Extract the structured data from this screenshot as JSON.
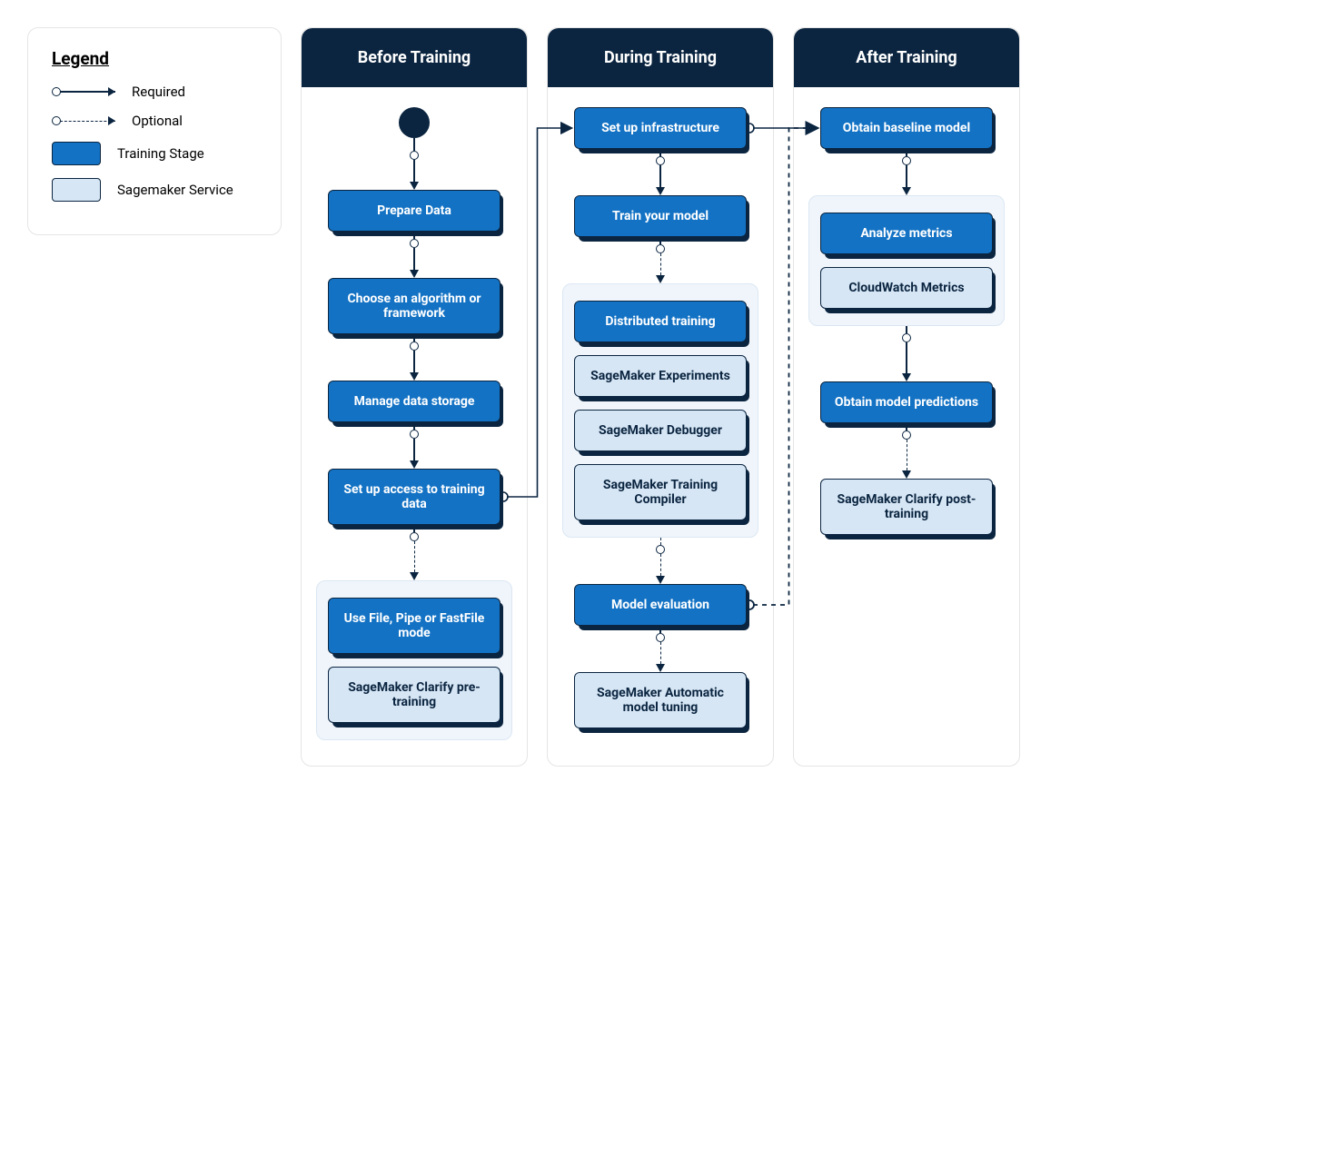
{
  "legend": {
    "title": "Legend",
    "required": "Required",
    "optional": "Optional",
    "training_stage": "Training Stage",
    "sagemaker_service": "Sagemaker Service"
  },
  "columns": {
    "before": {
      "header": "Before Training",
      "prepare_data": "Prepare Data",
      "choose_algo": "Choose an algorithm or framework",
      "manage_storage": "Manage data storage",
      "setup_access": "Set up access to training data",
      "file_mode": "Use File, Pipe or FastFile mode",
      "clarify_pre": "SageMaker Clarify pre-training"
    },
    "during": {
      "header": "During Training",
      "setup_infra": "Set up infrastructure",
      "train_model": "Train your model",
      "distributed": "Distributed training",
      "experiments": "SageMaker Experiments",
      "debugger": "SageMaker Debugger",
      "compiler": "SageMaker Training Compiler",
      "model_eval": "Model evaluation",
      "auto_tuning": "SageMaker Automatic model tuning"
    },
    "after": {
      "header": "After Training",
      "baseline": "Obtain baseline model",
      "analyze": "Analyze metrics",
      "cloudwatch": "CloudWatch Metrics",
      "predictions": "Obtain model predictions",
      "clarify_post": "SageMaker Clarify post-training"
    }
  }
}
